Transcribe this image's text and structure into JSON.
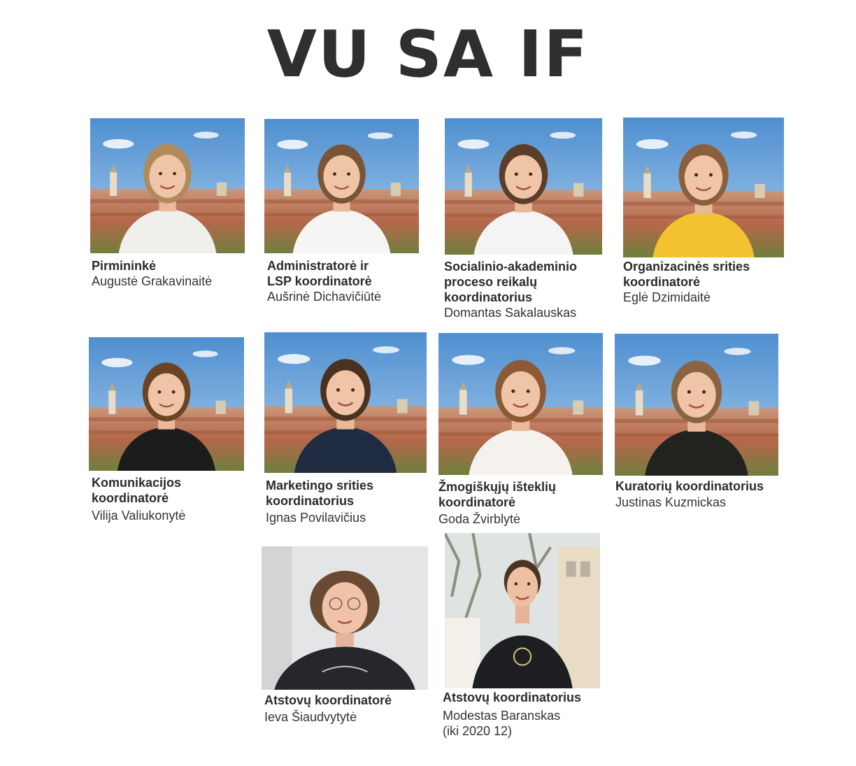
{
  "header": {
    "title": "VU SA IF"
  },
  "members": [
    {
      "role_lines": [
        "Pirmininkė"
      ],
      "name_lines": [
        "Augustė Grakavinaitė"
      ],
      "photo": "city-skyline",
      "shirt": "#f1efec",
      "hair": "#b08a5a"
    },
    {
      "role_lines": [
        "Administratorė ir",
        "LSP koordinatorė"
      ],
      "name_lines": [
        "Aušrinė Dichavičiūtė"
      ],
      "photo": "city-skyline",
      "shirt": "#f7f5f4",
      "hair": "#7a5438"
    },
    {
      "role_lines": [
        "Socialinio-akademinio",
        "proceso reikalų",
        "koordinatorius"
      ],
      "name_lines": [
        "Domantas Sakalauskas"
      ],
      "photo": "city-skyline",
      "shirt": "#f4f4f4",
      "hair": "#5a3e28"
    },
    {
      "role_lines": [
        "Organizacinės srities",
        "koordinatorė"
      ],
      "name_lines": [
        "Eglė Dzimidaitė"
      ],
      "photo": "city-skyline",
      "shirt": "#f2c230",
      "hair": "#8a5f3c"
    },
    {
      "role_lines": [
        "Komunikacijos",
        "koordinatorė"
      ],
      "name_lines": [
        "Vilija Valiukonytė"
      ],
      "photo": "city-skyline",
      "shirt": "#1c1c1c",
      "hair": "#6b4426"
    },
    {
      "role_lines": [
        "Marketingo srities",
        "koordinatorius"
      ],
      "name_lines": [
        "Ignas Povilavičius"
      ],
      "photo": "city-skyline",
      "shirt": "#1f2b40",
      "hair": "#4a3120"
    },
    {
      "role_lines": [
        "Žmogiškųjų išteklių",
        "koordinatorė"
      ],
      "name_lines": [
        "Goda Žvirblytė"
      ],
      "photo": "city-skyline",
      "shirt": "#f5f2ee",
      "hair": "#8c5a34"
    },
    {
      "role_lines": [
        "Kuratorių koordinatorius"
      ],
      "name_lines": [
        "Justinas Kuzmickas"
      ],
      "photo": "city-skyline",
      "shirt": "#22221e",
      "hair": "#8a6440"
    },
    {
      "role_lines": [
        "Atstovų koordinatorė"
      ],
      "name_lines": [
        "Ieva Šiaudvytytė"
      ],
      "photo": "indoor-wall",
      "shirt": "#26272a",
      "hair": "#6b4a33"
    },
    {
      "role_lines": [
        "Atstovų koordinatorius"
      ],
      "name_lines": [
        "Modestas Baranskas",
        "(iki 2020 12)"
      ],
      "photo": "tree-building",
      "shirt": "#1d1f22",
      "hair": "#4b3322"
    }
  ]
}
